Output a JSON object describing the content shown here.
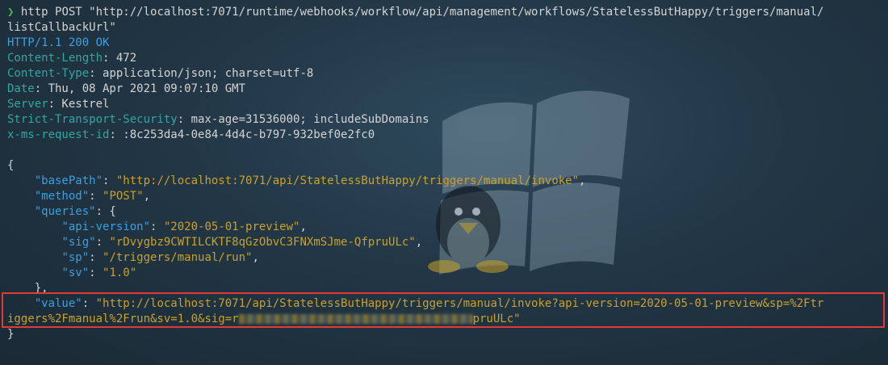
{
  "terminal": {
    "prompt": "❯",
    "command_line1": " http POST \"http://localhost:7071/runtime/webhooks/workflow/api/management/workflows/StatelessButHappy/triggers/manual/",
    "command_line2": "listCallbackUrl\"",
    "status": {
      "protocol": "HTTP",
      "version_code": "/1.1 200 OK"
    },
    "headers": [
      {
        "name": "Content-Length",
        "value": ": 472"
      },
      {
        "name": "Content-Type",
        "value": ": application/json; charset=utf-8"
      },
      {
        "name": "Date",
        "value": ": Thu, 08 Apr 2021 09:07:10 GMT"
      },
      {
        "name": "Server",
        "value": ": Kestrel"
      },
      {
        "name": "Strict-Transport-Security",
        "value": ": max-age=31536000; includeSubDomains"
      },
      {
        "name": "x-ms-request-id",
        "value": ": :8c253da4-0e84-4d4c-b797-932bef0e2fc0"
      }
    ],
    "json": {
      "open_brace": "{",
      "close_brace": "}",
      "basePath_key": "\"basePath\"",
      "basePath_value": "\"http://localhost:7071/api/StatelessButHappy/triggers/manual/invoke\"",
      "method_key": "\"method\"",
      "method_value": "\"POST\"",
      "queries_key": "\"queries\"",
      "queries_close": "},",
      "api_version_key": "\"api-version\"",
      "api_version_value": "\"2020-05-01-preview\"",
      "sig_key": "\"sig\"",
      "sig_value": "\"rDvygbz9CWTILCKTF8qGzObvC3FNXmSJme-QfpruULc\"",
      "sp_key": "\"sp\"",
      "sp_value": "\"/triggers/manual/run\"",
      "sv_key": "\"sv\"",
      "sv_value": "\"1.0\"",
      "value_key": "\"value\"",
      "value_line1": "\"http://localhost:7071/api/StatelessButHappy/triggers/manual/invoke?api-version=2020-05-01-preview&sp=%2Ftr",
      "value_line2_start": "iggers%2Fmanual%2Frun&sv=1.0&sig=r",
      "value_line2_end": "pruULc\""
    }
  },
  "colors": {
    "background": "#223645",
    "highlight_border": "#e53935"
  }
}
